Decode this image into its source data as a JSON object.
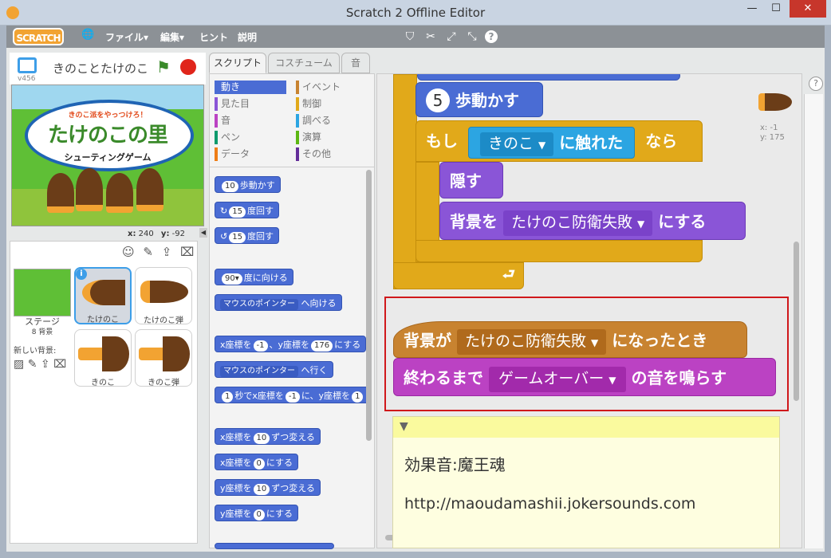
{
  "window": {
    "title": "Scratch 2 Offline Editor",
    "minimize": "—",
    "maximize": "☐",
    "close": "✕"
  },
  "menu": {
    "logo": "SCRATCH",
    "globe": "🌐",
    "file": "ファイル▾",
    "edit": "編集▾",
    "hint": "ヒント",
    "about": "説明"
  },
  "sprite": {
    "name": "きのことたけのこ",
    "version": "v456",
    "x_label": "x:",
    "x": "240",
    "y_label": "y:",
    "y": "-92"
  },
  "stage_art": {
    "banner": "きのこ派をやっつけろ！",
    "title": "たけのこの里",
    "subtitle": "シューティングゲーム"
  },
  "tabs": [
    "スクリプト",
    "コスチューム",
    "音"
  ],
  "categories": {
    "left": [
      {
        "label": "動き",
        "color": "#4a6cd4"
      },
      {
        "label": "見た目",
        "color": "#8a55d7"
      },
      {
        "label": "音",
        "color": "#bb42c3"
      },
      {
        "label": "ペン",
        "color": "#0e9a6c"
      },
      {
        "label": "データ",
        "color": "#ee7d16"
      }
    ],
    "right": [
      {
        "label": "イベント",
        "color": "#c88330"
      },
      {
        "label": "制御",
        "color": "#e1a91a"
      },
      {
        "label": "調べる",
        "color": "#2ca5e2"
      },
      {
        "label": "演算",
        "color": "#5cb712"
      },
      {
        "label": "その他",
        "color": "#632d99"
      }
    ]
  },
  "palette": {
    "move": {
      "n": "10",
      "t": "歩動かす"
    },
    "turn_right": {
      "n": "15",
      "t": "度回す"
    },
    "turn_left": {
      "n": "15",
      "t": "度回す"
    },
    "point_dir": {
      "n": "90▾",
      "t": "度に向ける"
    },
    "point_towards": {
      "d": "マウスのポインター",
      "t": "へ向ける"
    },
    "goto_xy": {
      "a": "x座標を",
      "x": "-1",
      "b": "、y座標を",
      "y": "176",
      "c": "にする"
    },
    "goto": {
      "d": "マウスのポインター",
      "t": "へ行く"
    },
    "glide": {
      "s": "1",
      "a": "秒でx座標を",
      "x": "-1",
      "b": "に、y座標を",
      "y": "1"
    },
    "change_x": {
      "a": "x座標を",
      "n": "10",
      "b": "ずつ変える"
    },
    "set_x": {
      "a": "x座標を",
      "n": "0",
      "b": "にする"
    },
    "change_y": {
      "a": "y座標を",
      "n": "10",
      "b": "ずつ変える"
    },
    "set_y": {
      "a": "y座標を",
      "n": "0",
      "b": "にする"
    }
  },
  "stage_panel": {
    "label": "ステージ",
    "count": "8 背景",
    "new_bg": "新しい背景:"
  },
  "sprite_list": [
    "たけのこ",
    "たけのこ弾",
    "きのこ",
    "きのこ弾"
  ],
  "script": {
    "move_n": "5",
    "move_t": "歩動かす",
    "if_a": "もし",
    "touching_target": "きのこ",
    "touching_t": "に触れた",
    "if_b": "なら",
    "hide": "隠す",
    "switch_a": "背景を",
    "switch_bg": "たけのこ防衛失敗",
    "switch_b": "にする",
    "hat_a": "背景が",
    "hat_bg": "たけのこ防衛失敗",
    "hat_b": "になったとき",
    "play_a": "終わるまで",
    "play_sound": "ゲームオーバー",
    "play_b": "の音を鳴らす",
    "corner_x": "x: -1",
    "corner_y": "y: 175"
  },
  "comment": {
    "line1": "効果音:魔王魂",
    "line2": "http://maoudamashii.jokersounds.com"
  }
}
